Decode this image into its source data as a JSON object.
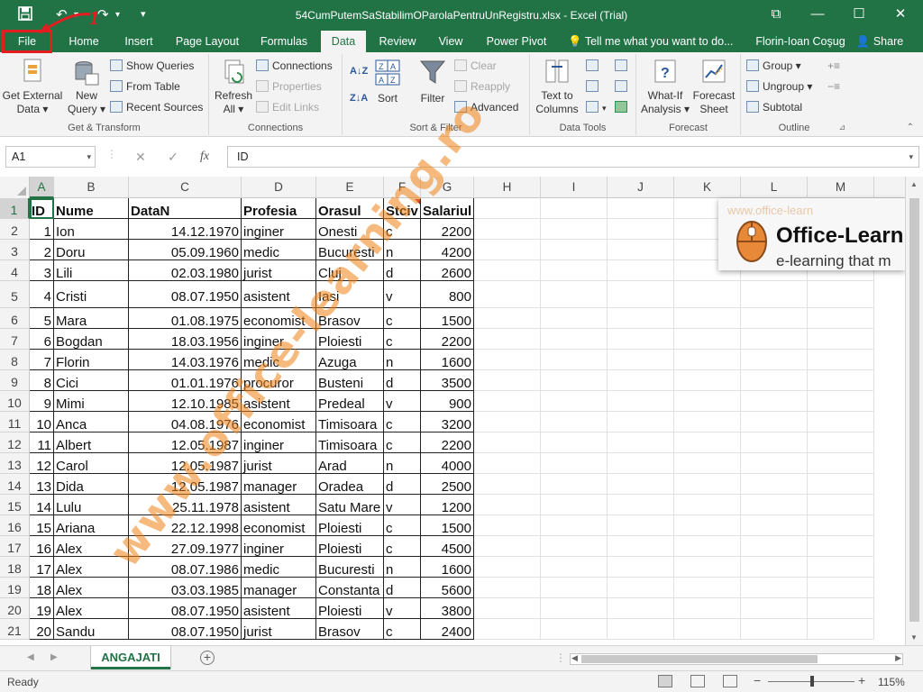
{
  "titlebar": {
    "title": "54CumPutemSaStabilimOParolaPentruUnRegistru.xlsx - Excel (Trial)",
    "save_icon": "💾",
    "undo_icon": "↶",
    "redo_icon": "↷",
    "customize_icon": "▾",
    "restore_icon": "⧉",
    "minimize_icon": "—",
    "maximize_icon": "☐",
    "close_icon": "✕"
  },
  "annotation": {
    "callout_number": "1",
    "color": "#e41e20"
  },
  "tabs": [
    "File",
    "Home",
    "Insert",
    "Page Layout",
    "Formulas",
    "Data",
    "Review",
    "View",
    "Power Pivot"
  ],
  "active_tab": "Data",
  "tell_me": "Tell me what you want to do...",
  "user": "Florin-Ioan Coşug",
  "share": "Share",
  "ribbon": {
    "get_transform": {
      "label": "Get & Transform",
      "get_external": [
        "Get External",
        "Data ▾"
      ],
      "new_query": [
        "New",
        "Query ▾"
      ],
      "show_queries": "Show Queries",
      "from_table": "From Table",
      "recent_sources": "Recent Sources"
    },
    "connections": {
      "label": "Connections",
      "refresh": [
        "Refresh",
        "All ▾"
      ],
      "connections": "Connections",
      "properties": "Properties",
      "edit_links": "Edit Links"
    },
    "sort_filter": {
      "label": "Sort & Filter",
      "sort": "Sort",
      "filter": "Filter",
      "clear": "Clear",
      "reapply": "Reapply",
      "advanced": "Advanced"
    },
    "data_tools": {
      "label": "Data Tools",
      "text_to_columns": [
        "Text to",
        "Columns"
      ]
    },
    "forecast": {
      "label": "Forecast",
      "whatif": [
        "What-If",
        "Analysis ▾"
      ],
      "forecast_sheet": [
        "Forecast",
        "Sheet"
      ]
    },
    "outline": {
      "label": "Outline",
      "group": "Group ▾",
      "ungroup": "Ungroup ▾",
      "subtotal": "Subtotal"
    }
  },
  "formula_bar": {
    "name_box": "A1",
    "cancel": "✕",
    "enter": "✓",
    "fx": "fx",
    "value": "ID"
  },
  "columns": [
    "A",
    "B",
    "C",
    "D",
    "E",
    "F",
    "G",
    "H",
    "I",
    "J",
    "K",
    "L",
    "M"
  ],
  "headers": [
    "ID",
    "Nume",
    "DataN",
    "Profesia",
    "Orasul",
    "Stciv",
    "Salariul"
  ],
  "rows": [
    [
      "1",
      "Ion",
      "14.12.1970",
      "inginer",
      "Onesti",
      "c",
      "2200"
    ],
    [
      "2",
      "Doru",
      "05.09.1960",
      "medic",
      "Bucuresti",
      "n",
      "4200"
    ],
    [
      "3",
      "Lili",
      "02.03.1980",
      "jurist",
      "Cluj",
      "d",
      "2600"
    ],
    [
      "4",
      "Cristi",
      "08.07.1950",
      "asistent",
      "Iasi",
      "v",
      "800"
    ],
    [
      "5",
      "Mara",
      "01.08.1975",
      "economist",
      "Brasov",
      "c",
      "1500"
    ],
    [
      "6",
      "Bogdan",
      "18.03.1956",
      "inginer",
      "Ploiesti",
      "c",
      "2200"
    ],
    [
      "7",
      "Florin",
      "14.03.1976",
      "medic",
      "Azuga",
      "n",
      "1600"
    ],
    [
      "8",
      "Cici",
      "01.01.1976",
      "procuror",
      "Busteni",
      "d",
      "3500"
    ],
    [
      "9",
      "Mimi",
      "12.10.1985",
      "asistent",
      "Predeal",
      "v",
      "900"
    ],
    [
      "10",
      "Anca",
      "04.08.1976",
      "economist",
      "Timisoara",
      "c",
      "3200"
    ],
    [
      "11",
      "Albert",
      "12.05.1987",
      "inginer",
      "Timisoara",
      "c",
      "2200"
    ],
    [
      "12",
      "Carol",
      "12.05.1987",
      "jurist",
      "Arad",
      "n",
      "4000"
    ],
    [
      "13",
      "Dida",
      "12.05.1987",
      "manager",
      "Oradea",
      "d",
      "2500"
    ],
    [
      "14",
      "Lulu",
      "25.11.1978",
      "asistent",
      "Satu Mare",
      "v",
      "1200"
    ],
    [
      "15",
      "Ariana",
      "22.12.1998",
      "economist",
      "Ploiesti",
      "c",
      "1500"
    ],
    [
      "16",
      "Alex",
      "27.09.1977",
      "inginer",
      "Ploiesti",
      "c",
      "4500"
    ],
    [
      "17",
      "Alex",
      "08.07.1986",
      "medic",
      "Bucuresti",
      "n",
      "1600"
    ],
    [
      "18",
      "Alex",
      "03.03.1985",
      "manager",
      "Constanta",
      "d",
      "5600"
    ],
    [
      "19",
      "Alex",
      "08.07.1950",
      "asistent",
      "Ploiesti",
      "v",
      "3800"
    ],
    [
      "20",
      "Sandu",
      "08.07.1950",
      "jurist",
      "Brasov",
      "c",
      "2400"
    ]
  ],
  "row_numbers": [
    "1",
    "2",
    "3",
    "4",
    "5",
    "6",
    "7",
    "8",
    "9",
    "10",
    "11",
    "12",
    "13",
    "14",
    "15",
    "16",
    "17",
    "18",
    "19",
    "20",
    "21"
  ],
  "logo": {
    "brand": "Office-Learn",
    "tagline": "e-learning that m",
    "faint": "www.office-learn"
  },
  "watermark": "www.office-learning.ro",
  "sheet_tab": "ANGAJATI",
  "add_sheet": "+",
  "status": {
    "ready": "Ready",
    "zoom": "115%",
    "minus": "−",
    "plus": "+"
  },
  "colors": {
    "accent": "#217346",
    "annotation": "#e41e20",
    "watermark": "#f0821e"
  }
}
